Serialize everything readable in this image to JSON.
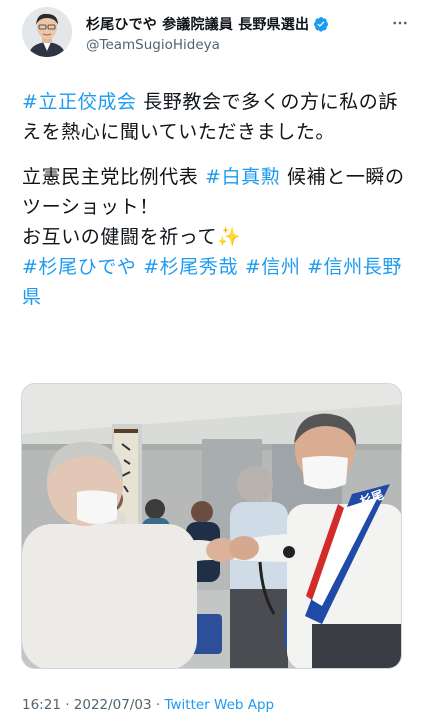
{
  "header": {
    "display_name": "杉尾ひでや 参議院議員 長野県選出",
    "handle": "@TeamSugioHideya"
  },
  "tweet": {
    "p1": {
      "tag1": "#立正佼成会",
      "text1": " 長野教会で多くの方に私の訴えを熱心に聞いていただきました。"
    },
    "p2": {
      "text1": "立憲民主党比例代表 ",
      "tag1": "#白真勲",
      "text2": " 候補と一瞬のツーショット！",
      "text3": "お互いの健闘を祈って",
      "emoji": "✨",
      "tag2": "#杉尾ひでや",
      "tag3": "#杉尾秀哉",
      "tag4": "#信州",
      "tag5": "#信州長野県"
    }
  },
  "media": {
    "sash_text": "杉尾"
  },
  "meta": {
    "time": "16:21",
    "sep1": " · ",
    "date": "2022/07/03",
    "sep2": " · ",
    "source": "Twitter Web App"
  },
  "colors": {
    "link": "#1d9bf0",
    "secondary_text": "#536471",
    "verified": "#1d9bf0"
  }
}
